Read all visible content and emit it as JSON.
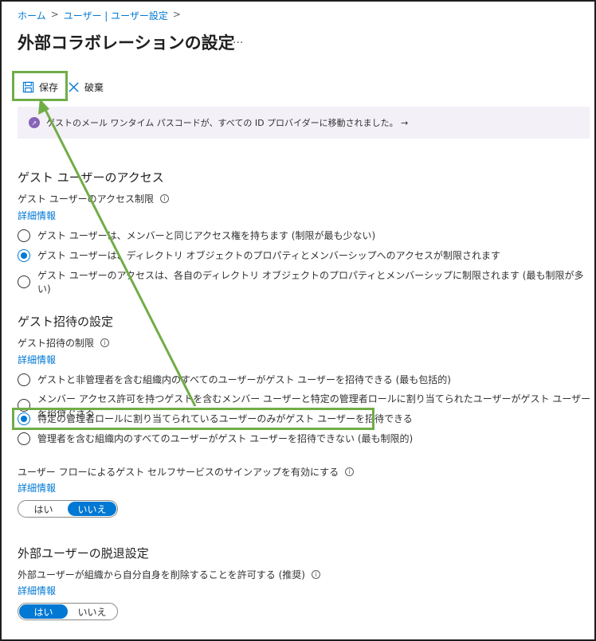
{
  "breadcrumb": {
    "home": "ホーム",
    "sep1": ">",
    "users": "ユーザー | ユーザー設定",
    "sep2": ">"
  },
  "page": {
    "title": "外部コラボレーションの設定",
    "more": "..."
  },
  "toolbar": {
    "save_label": "保存",
    "discard_label": "破棄"
  },
  "banner": {
    "text": "ゲストのメール ワンタイム パスコードが、すべての ID プロバイダーに移動されました。 →"
  },
  "guest_access": {
    "title": "ゲスト ユーザーのアクセス",
    "label": "ゲスト ユーザーのアクセス制限",
    "link": "詳細情報",
    "options": [
      "ゲスト ユーザーは、メンバーと同じアクセス権を持ちます (制限が最も少ない)",
      "ゲスト ユーザーは、ディレクトリ オブジェクトのプロパティとメンバーシップへのアクセスが制限されます",
      "ゲスト ユーザーのアクセスは、各自のディレクトリ オブジェクトのプロパティとメンバーシップに制限されます (最も制限が多い)"
    ],
    "selected": 1
  },
  "guest_invite": {
    "title": "ゲスト招待の設定",
    "label": "ゲスト招待の制限",
    "link": "詳細情報",
    "options": [
      "ゲストと非管理者を含む組織内のすべてのユーザーがゲスト ユーザーを招待できる (最も包括的)",
      "メンバー アクセス許可を持つゲストを含むメンバー ユーザーと特定の管理者ロールに割り当てられたユーザーがゲスト ユーザーを招待できる",
      "特定の管理者ロールに割り当てられているユーザーのみがゲスト ユーザーを招待できる",
      "管理者を含む組織内のすべてのユーザーがゲスト ユーザーを招待できない (最も制限的)"
    ],
    "selected": 2
  },
  "self_service": {
    "label": "ユーザー フローによるゲスト セルフサービスのサインアップを有効にする",
    "link": "詳細情報",
    "yes": "はい",
    "no": "いいえ",
    "value": "いいえ"
  },
  "leave": {
    "title": "外部ユーザーの脱退設定",
    "label": "外部ユーザーが組織から自分自身を削除することを許可する (推奨)",
    "link": "詳細情報",
    "yes": "はい",
    "no": "いいえ",
    "value": "はい"
  },
  "icons": {
    "info": "i",
    "rocket": "rocket-icon",
    "save": "save-icon",
    "discard": "close-icon"
  },
  "colors": {
    "accent": "#0078d4",
    "highlight": "#70ad47",
    "banner": "#f3f0f8"
  }
}
